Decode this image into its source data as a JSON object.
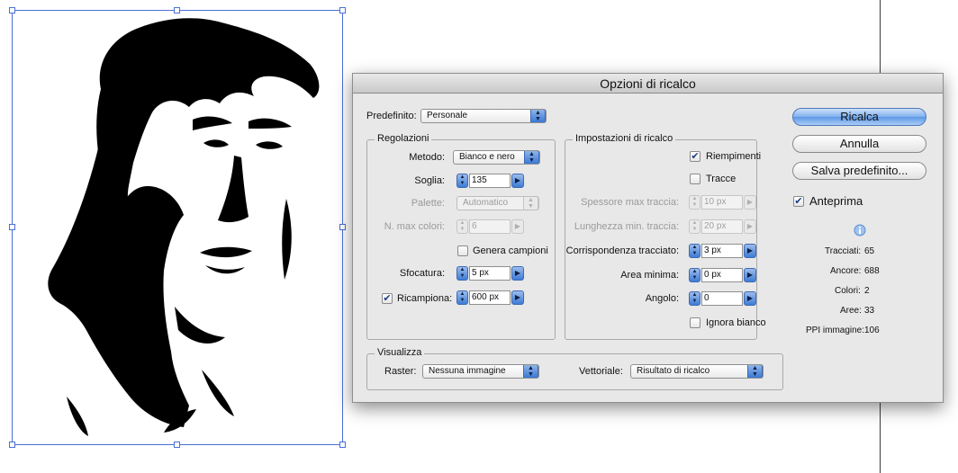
{
  "dialog": {
    "title": "Opzioni di ricalco",
    "preset_label": "Predefinito:",
    "preset_value": "Personale"
  },
  "regolazioni": {
    "title": "Regolazioni",
    "metodo_label": "Metodo:",
    "metodo_value": "Bianco e nero",
    "soglia_label": "Soglia:",
    "soglia_value": "135",
    "palette_label": "Palette:",
    "palette_value": "Automatico",
    "max_colori_label": "N. max colori:",
    "max_colori_value": "6",
    "genera_campioni_label": "Genera campioni",
    "sfocatura_label": "Sfocatura:",
    "sfocatura_value": "5 px",
    "ricampiona_label": "Ricampiona:",
    "ricampiona_value": "600 px"
  },
  "impostazioni": {
    "title": "Impostazioni di ricalco",
    "riempimenti_label": "Riempimenti",
    "tracce_label": "Tracce",
    "spessore_label": "Spessore max traccia:",
    "spessore_value": "10 px",
    "lunghezza_label": "Lunghezza min. traccia:",
    "lunghezza_value": "20 px",
    "corrispondenza_label": "Corrispondenza tracciato:",
    "corrispondenza_value": "3 px",
    "area_label": "Area minima:",
    "area_value": "0 px",
    "angolo_label": "Angolo:",
    "angolo_value": "0",
    "ignora_bianco_label": "Ignora bianco"
  },
  "visualizza": {
    "title": "Visualizza",
    "raster_label": "Raster:",
    "raster_value": "Nessuna immagine",
    "vettoriale_label": "Vettoriale:",
    "vettoriale_value": "Risultato di ricalco"
  },
  "buttons": {
    "ricalca": "Ricalca",
    "annulla": "Annulla",
    "salva": "Salva predefinito...",
    "anteprima": "Anteprima"
  },
  "stats": {
    "tracciati_label": "Tracciati:",
    "tracciati_value": "65",
    "ancore_label": "Ancore:",
    "ancore_value": "688",
    "colori_label": "Colori:",
    "colori_value": "2",
    "aree_label": "Aree:",
    "aree_value": "33",
    "ppi_label": "PPI immagine:",
    "ppi_value": "106"
  },
  "colors": {
    "accent": "#5d98e6",
    "selection": "#4a6fd6"
  },
  "icons": [
    "info-icon",
    "checkmark-icon",
    "stepper-arrows-icon",
    "popup-arrows-icon"
  ]
}
